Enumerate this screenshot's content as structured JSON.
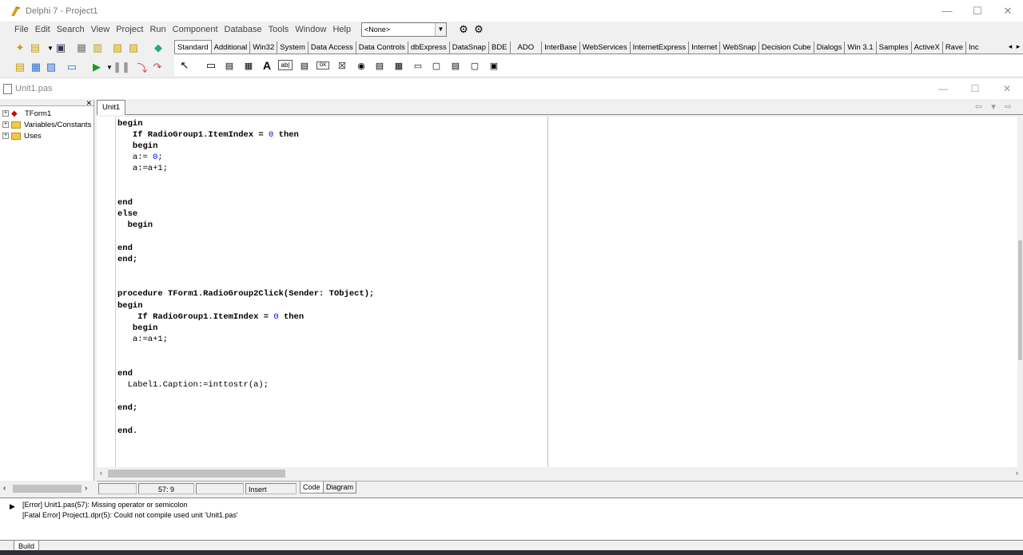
{
  "window": {
    "title": "Delphi 7 - Project1",
    "controls": {
      "minimize": "—",
      "maximize": "☐",
      "close": "✕"
    }
  },
  "menu": [
    "File",
    "Edit",
    "Search",
    "View",
    "Project",
    "Run",
    "Component",
    "Database",
    "Tools",
    "Window",
    "Help"
  ],
  "toolbar": {
    "combo_value": "<None>"
  },
  "palette": {
    "tabs": [
      "Standard",
      "Additional",
      "Win32",
      "System",
      "Data Access",
      "Data Controls",
      "dbExpress",
      "DataSnap",
      "BDE",
      "ADO",
      "InterBase",
      "WebServices",
      "InternetExpress",
      "Internet",
      "WebSnap",
      "Decision Cube",
      "Dialogs",
      "Win 3.1",
      "Samples",
      "ActiveX",
      "Rave",
      "Inc"
    ],
    "active_tab": "Standard",
    "component_glyphs": {
      "label": "A",
      "edit": "ab|",
      "button": "OK",
      "checkbox": "☒",
      "radio": "◉"
    }
  },
  "editor": {
    "title": "Unit1.pas",
    "tab": "Unit1",
    "tree": [
      {
        "label": "TForm1"
      },
      {
        "label": "Variables/Constants"
      },
      {
        "label": "Uses"
      }
    ],
    "status": {
      "position": "57:  9",
      "mode": "Insert",
      "view_tabs": [
        "Code",
        "Diagram"
      ]
    }
  },
  "code_lines": {
    "l1": "begin",
    "l2a": "   If RadioGroup1.ItemIndex = ",
    "l2n": "0",
    "l2b": " then",
    "l3": "   begin",
    "l4a": "   a:= ",
    "l4n": "0",
    "l4b": ";",
    "l5": "   a:=a+1;",
    "l6": "end",
    "l7": "else",
    "l8": "  begin",
    "l9": "end",
    "l10": "end;",
    "l11": "procedure TForm1.RadioGroup2Click(Sender: TObject);",
    "l12": "begin",
    "l13a": "    If RadioGroup1.ItemIndex = ",
    "l13n": "0",
    "l13b": " then",
    "l14": "   begin",
    "l15": "   a:=a+1;",
    "l16": "end",
    "l17": "  Label1.Caption:=inttostr(a);",
    "l18": "end;",
    "l19": "end."
  },
  "messages": {
    "error1": "[Error] Unit1.pas(57): Missing operator or semicolon",
    "error2": "[Fatal Error] Project1.dpr(5): Could not compile used unit 'Unit1.pas'",
    "tab": "Build"
  }
}
